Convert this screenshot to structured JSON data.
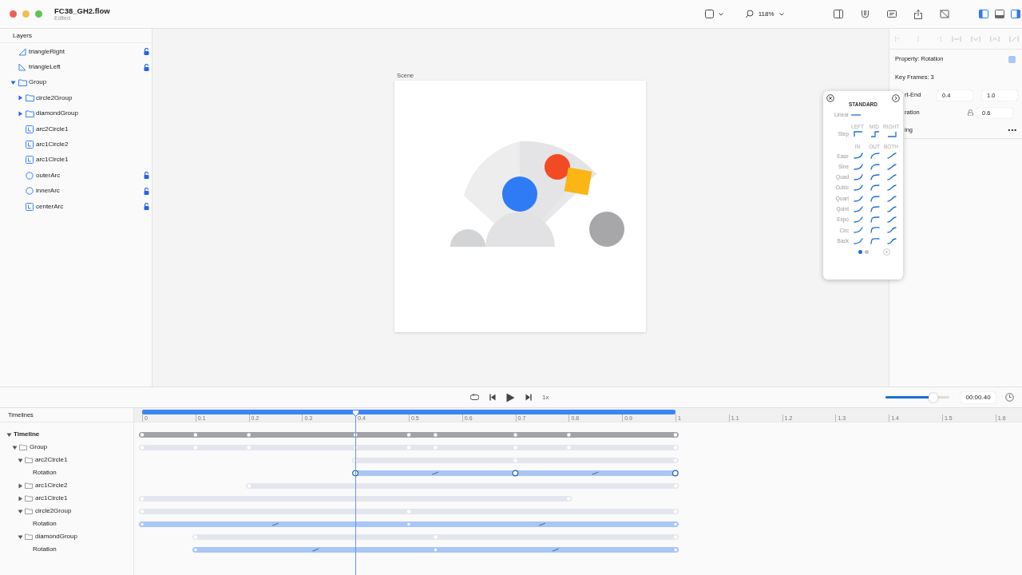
{
  "window": {
    "title": "FC38_GH2.flow",
    "subtitle": "Edited"
  },
  "toolbar": {
    "zoom": "118%",
    "layout_toggles": [
      {
        "on": true
      },
      {
        "on": false
      },
      {
        "on": true
      }
    ]
  },
  "layers": {
    "title": "Layers",
    "items": [
      {
        "name": "triangleRight",
        "kind": "triangle-right",
        "locked": true
      },
      {
        "name": "triangleLeft",
        "kind": "triangle-left",
        "locked": true
      },
      {
        "name": "Group",
        "kind": "folder",
        "locked": false,
        "expanded": true,
        "children": [
          {
            "name": "circle2Group",
            "kind": "folder",
            "locked": false,
            "expanded": false
          },
          {
            "name": "diamondGroup",
            "kind": "folder",
            "locked": false,
            "expanded": false
          },
          {
            "name": "arc2Circle1",
            "kind": "layer",
            "locked": false
          },
          {
            "name": "arc1Circle2",
            "kind": "layer",
            "locked": false
          },
          {
            "name": "arc1Circle1",
            "kind": "layer",
            "locked": false
          },
          {
            "name": "outerArc",
            "kind": "circle",
            "locked": true
          },
          {
            "name": "innerArc",
            "kind": "circle",
            "locked": true
          },
          {
            "name": "centerArc",
            "kind": "layer",
            "locked": true
          }
        ]
      }
    ]
  },
  "scene": {
    "label": "Scene"
  },
  "inspector": {
    "property": "Property: Rotation",
    "color": "#a8c7f7",
    "key_frames": "Key Frames: 3",
    "start_end_label": "rt-End",
    "start": "0.4",
    "end": "1.0",
    "duration_label": "ration",
    "duration": "0.6",
    "easing_label": "ing",
    "more": "•••"
  },
  "easing_popup": {
    "title": "STANDARD",
    "linear": "Linear",
    "step_columns": [
      "LEFT",
      "MID",
      "RIGHT"
    ],
    "step": "Step",
    "columns": [
      "IN",
      "OUT",
      "BOTH"
    ],
    "rows": [
      "Ease",
      "Sine",
      "Quad",
      "Cubic",
      "Quart",
      "Quint",
      "Expo",
      "Circ",
      "Back"
    ],
    "pages": [
      {
        "selected": true
      },
      {
        "selected": false
      }
    ]
  },
  "playback": {
    "speed": "1x",
    "level": 0.75,
    "time": "00:00.40"
  },
  "timelines": {
    "title": "Timelines",
    "ruler": [
      "0",
      "0.1",
      "0.2",
      "0.3",
      "0.4",
      "0.5",
      "0.6",
      "0.7",
      "0.8",
      "0.9",
      "1",
      "1.1",
      "1.2",
      "1.3",
      "1.4",
      "1.5",
      "1.6"
    ],
    "tree": [
      {
        "name": "Timeline",
        "kind": "timeline",
        "expanded": true,
        "children": [
          {
            "name": "Group",
            "kind": "folder",
            "expanded": true,
            "children": [
              {
                "name": "arc2Circle1",
                "kind": "folder",
                "expanded": true,
                "children": [
                  {
                    "name": "Rotation",
                    "kind": "property"
                  }
                ]
              },
              {
                "name": "arc1Circle2",
                "kind": "folder",
                "expanded": false
              },
              {
                "name": "arc1Circle1",
                "kind": "folder",
                "expanded": false
              },
              {
                "name": "circle2Group",
                "kind": "folder",
                "expanded": true,
                "children": [
                  {
                    "name": "Rotation",
                    "kind": "property"
                  }
                ]
              },
              {
                "name": "diamondGroup",
                "kind": "folder",
                "expanded": true,
                "children": [
                  {
                    "name": "Rotation",
                    "kind": "property"
                  }
                ]
              }
            ]
          }
        ]
      }
    ]
  }
}
